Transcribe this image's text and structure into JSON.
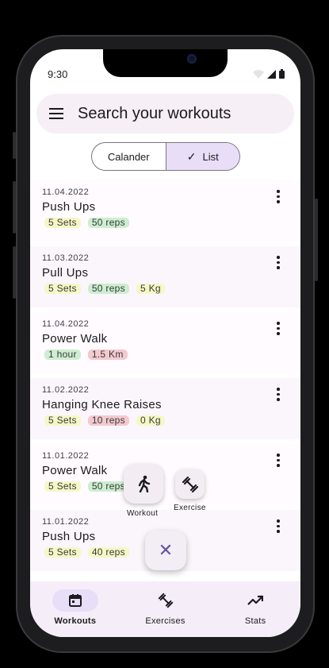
{
  "status": {
    "time": "9:30"
  },
  "search": {
    "placeholder": "Search your workouts"
  },
  "segmented": {
    "options": [
      "Calander",
      "List"
    ],
    "selected": "List"
  },
  "workouts": [
    {
      "date": "11.04.2022",
      "title": "Push Ups",
      "tags": [
        {
          "text": "5 Sets",
          "color": "#f5f7c6"
        },
        {
          "text": "50 reps",
          "color": "#cdeed0"
        }
      ]
    },
    {
      "date": "11.03.2022",
      "title": "Pull Ups",
      "tags": [
        {
          "text": "5 Sets",
          "color": "#f5f7c6"
        },
        {
          "text": "50 reps",
          "color": "#cdeed0"
        },
        {
          "text": "5 Kg",
          "color": "#f5f7c6"
        }
      ]
    },
    {
      "date": "11.04.2022",
      "title": "Power Walk",
      "tags": [
        {
          "text": "1 hour",
          "color": "#cdeed0"
        },
        {
          "text": "1.5 Km",
          "color": "#f3c9cf"
        }
      ]
    },
    {
      "date": "11.02.2022",
      "title": "Hanging Knee Raises",
      "tags": [
        {
          "text": "5 Sets",
          "color": "#f5f7c6"
        },
        {
          "text": "10 reps",
          "color": "#f3c9cf"
        },
        {
          "text": "0 Kg",
          "color": "#f5f7c6"
        }
      ]
    },
    {
      "date": "11.01.2022",
      "title": "Power Walk",
      "tags": [
        {
          "text": "5 Sets",
          "color": "#f5f7c6"
        },
        {
          "text": "50 reps",
          "color": "#cdeed0"
        }
      ]
    },
    {
      "date": "11.01.2022",
      "title": "Push Ups",
      "tags": [
        {
          "text": "5 Sets",
          "color": "#f5f7c6"
        },
        {
          "text": "40 reps",
          "color": "#f5f7c6"
        }
      ]
    }
  ],
  "fab": {
    "workout_label": "Workout",
    "exercise_label": "Exercise",
    "close_icon": "close-icon"
  },
  "nav": {
    "items": [
      {
        "label": "Workouts",
        "icon": "calendar-icon",
        "active": true
      },
      {
        "label": "Exercises",
        "icon": "dumbbell-icon",
        "active": false
      },
      {
        "label": "Stats",
        "icon": "trending-up-icon",
        "active": false
      }
    ]
  },
  "colors": {
    "accent": "#6750a4",
    "selected": "#e8def8"
  }
}
